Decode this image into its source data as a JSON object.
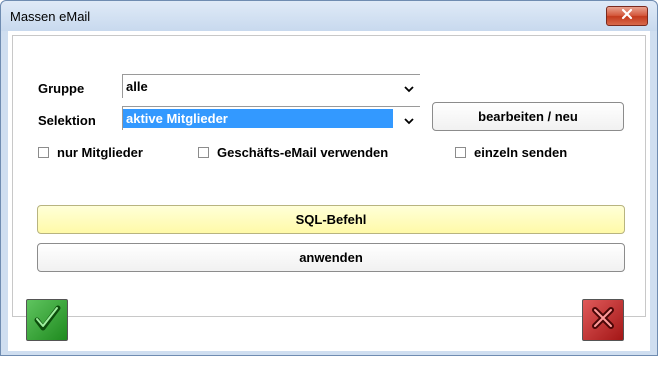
{
  "window": {
    "title": "Massen eMail"
  },
  "form": {
    "gruppe_label": "Gruppe",
    "gruppe_value": "alle",
    "selektion_label": "Selektion",
    "selektion_value": "aktive Mitglieder",
    "edit_button": "bearbeiten / neu",
    "options": [
      {
        "label": "nur Mitglieder",
        "checked": false
      },
      {
        "label": "Geschäfts-eMail verwenden",
        "checked": false
      },
      {
        "label": "einzeln senden",
        "checked": false
      }
    ],
    "sql_button": "SQL-Befehl",
    "apply_button": "anwenden"
  },
  "icons": {
    "close": "close-icon",
    "ok": "checkmark-icon",
    "cancel": "x-icon",
    "dropdown": "chevron-down-icon"
  },
  "colors": {
    "selection": "#3399ff",
    "sql_button": "#fffaa8",
    "ok": "#2e9e2e",
    "cancel": "#c62828"
  }
}
